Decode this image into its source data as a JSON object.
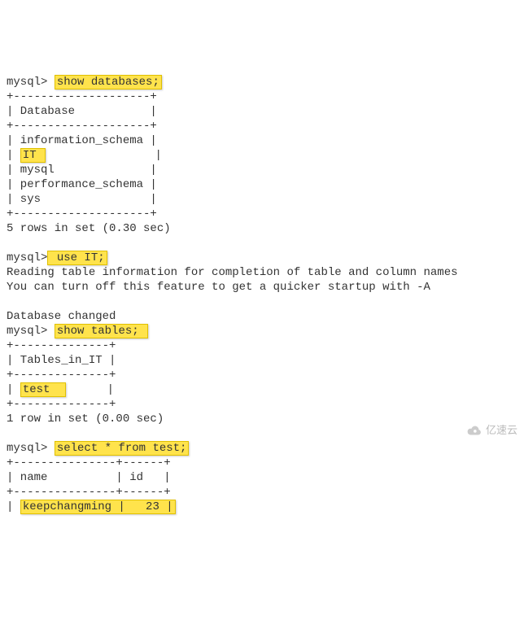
{
  "prompt": "mysql>",
  "cmd_show_db": "show databases;",
  "db_border": "+--------------------+",
  "db_header": "| Database           |",
  "db_row_info": "| information_schema |",
  "db_row_it_pre": "| ",
  "db_it": "IT ",
  "db_row_it_post": "                |",
  "db_row_mysql": "| mysql              |",
  "db_row_perf": "| performance_schema |",
  "db_row_sys": "| sys                |",
  "db_footer": "5 rows in set (0.30 sec)",
  "cmd_use_it": " use IT;",
  "reading1": "Reading table information for completion of table and column names",
  "reading2": "You can turn off this feature to get a quicker startup with -A",
  "db_changed": "Database changed",
  "cmd_show_tables": "show tables; ",
  "tbl_border": "+--------------+",
  "tbl_header": "| Tables_in_IT |",
  "tbl_row_pre": "| ",
  "test": "test  ",
  "tbl_row_post": "      |",
  "tbl_footer": "1 row in set (0.00 sec)",
  "cmd_select": "select * from test;",
  "sel_border": "+---------------+------+",
  "sel_header": "| name          | id   |",
  "sel_row_pre": "| ",
  "sel_row": "keepchangming |   23 |",
  "watermark": "亿速云"
}
